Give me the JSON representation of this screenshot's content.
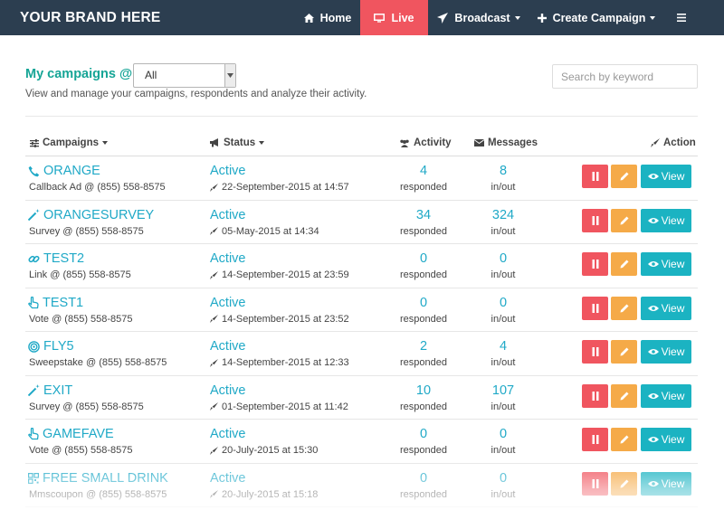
{
  "brand": "YOUR BRAND HERE",
  "nav": {
    "home": "Home",
    "live": "Live",
    "broadcast": "Broadcast",
    "create_campaign": "Create Campaign",
    "menu_icon": "hamburger-menu-icon"
  },
  "colors": {
    "navbar": "#2c3e50",
    "live_active": "#f0555f",
    "title_teal": "#16a596",
    "link_blue": "#20a9c7",
    "pause_red": "#f0555f",
    "edit_orange": "#f5aa48",
    "view_teal": "#1bb3c2"
  },
  "header": {
    "title": "My campaigns @",
    "filter_value": "All",
    "subtitle": "View and manage your campaigns, respondents and analyze their activity.",
    "search_placeholder": "Search by keyword"
  },
  "table": {
    "columns": {
      "campaigns": "Campaigns",
      "status": "Status",
      "activity": "Activity",
      "messages": "Messages",
      "action": "Action"
    },
    "view_label": "View",
    "rows": [
      {
        "name": "ORANGE",
        "icon": "phone-icon",
        "sub": "Callback Ad @ (855) 558-8575",
        "status": "Active",
        "date": "22-September-2015 at 14:57",
        "activity": "4",
        "activity_label": "responded",
        "messages": "8",
        "messages_label": "in/out"
      },
      {
        "name": "ORANGESURVEY",
        "icon": "magic-wand-icon",
        "sub": "Survey @ (855) 558-8575",
        "status": "Active",
        "date": "05-May-2015 at 14:34",
        "activity": "34",
        "activity_label": "responded",
        "messages": "324",
        "messages_label": "in/out"
      },
      {
        "name": "TEST2",
        "icon": "link-icon",
        "sub": "Link @ (855) 558-8575",
        "status": "Active",
        "date": "14-September-2015 at 23:59",
        "activity": "0",
        "activity_label": "responded",
        "messages": "0",
        "messages_label": "in/out"
      },
      {
        "name": "TEST1",
        "icon": "hand-pointer-icon",
        "sub": "Vote @ (855) 558-8575",
        "status": "Active",
        "date": "14-September-2015 at 23:52",
        "activity": "0",
        "activity_label": "responded",
        "messages": "0",
        "messages_label": "in/out"
      },
      {
        "name": "FLY5",
        "icon": "bullseye-icon",
        "sub": "Sweepstake @ (855) 558-8575",
        "status": "Active",
        "date": "14-September-2015 at 12:33",
        "activity": "2",
        "activity_label": "responded",
        "messages": "4",
        "messages_label": "in/out"
      },
      {
        "name": "EXIT",
        "icon": "magic-wand-icon",
        "sub": "Survey @ (855) 558-8575",
        "status": "Active",
        "date": "01-September-2015 at 11:42",
        "activity": "10",
        "activity_label": "responded",
        "messages": "107",
        "messages_label": "in/out"
      },
      {
        "name": "GAMEFAVE",
        "icon": "hand-pointer-icon",
        "sub": "Vote @ (855) 558-8575",
        "status": "Active",
        "date": "20-July-2015 at 15:30",
        "activity": "0",
        "activity_label": "responded",
        "messages": "0",
        "messages_label": "in/out"
      },
      {
        "name": "FREE SMALL DRINK",
        "icon": "qrcode-icon",
        "sub": "Mmscoupon @ (855) 558-8575",
        "status": "Active",
        "date": "20-July-2015 at 15:18",
        "activity": "0",
        "activity_label": "responded",
        "messages": "0",
        "messages_label": "in/out"
      }
    ]
  }
}
